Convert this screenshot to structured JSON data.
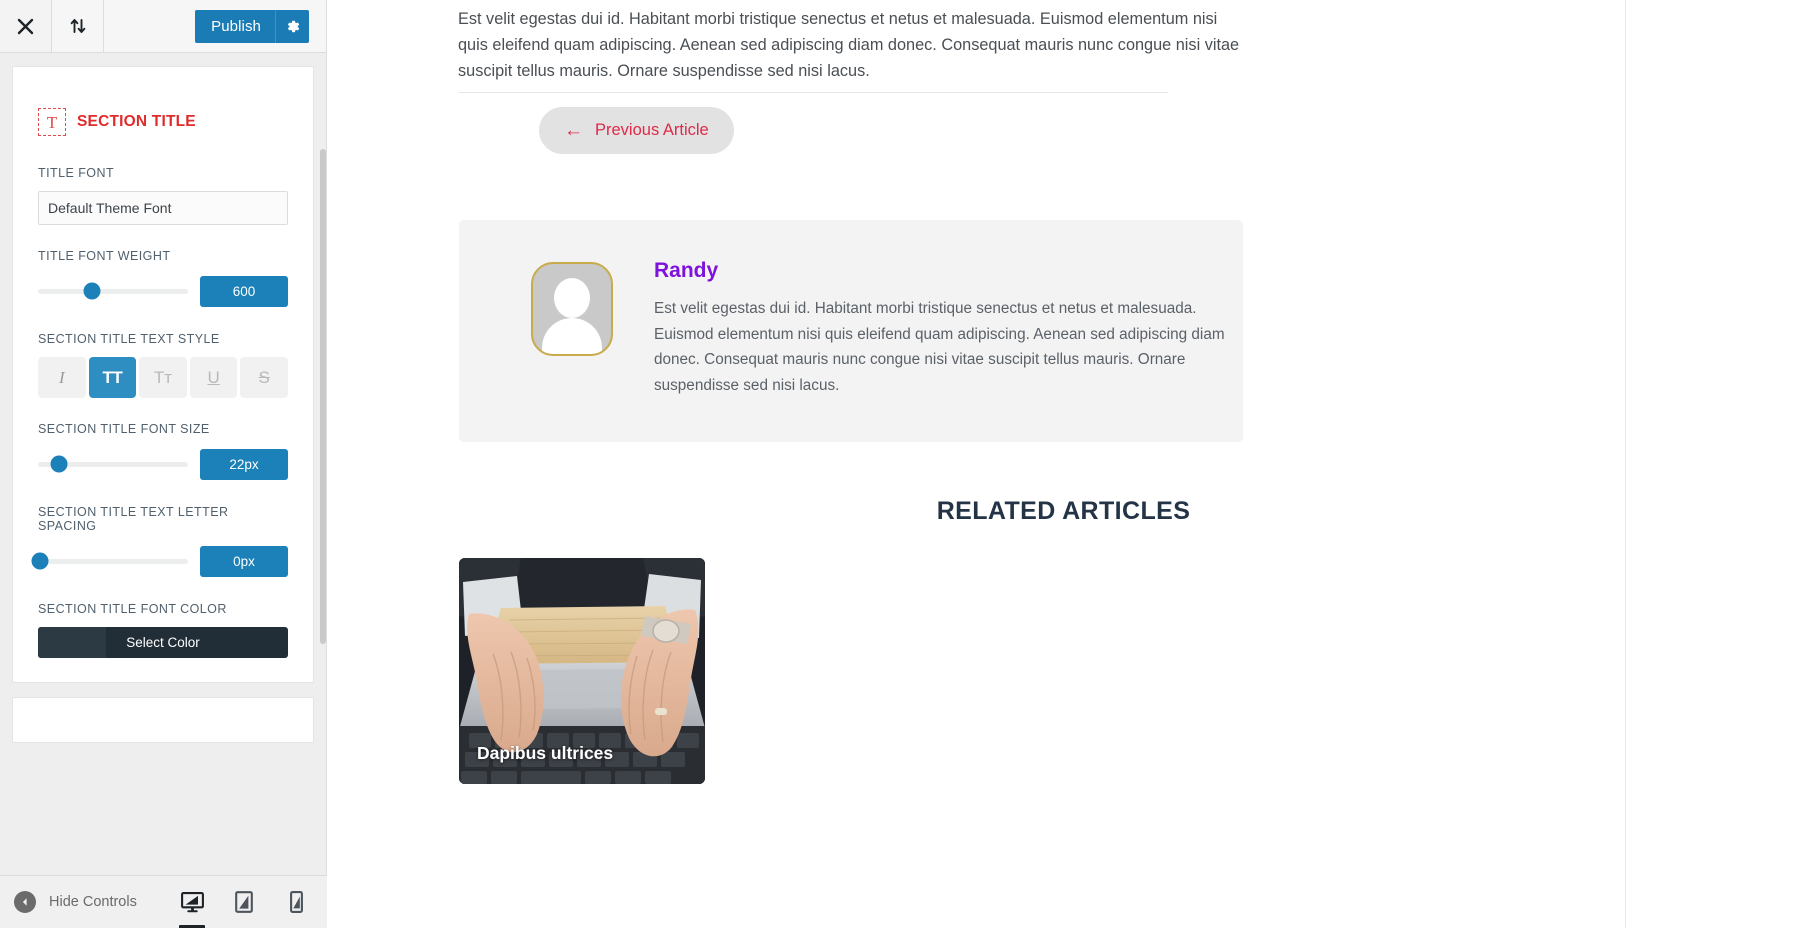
{
  "customizer": {
    "header": {
      "close_icon": "close-icon",
      "reorder_icon": "sort-updown-icon",
      "publish_label": "Publish",
      "gear_icon": "gear-icon"
    },
    "section": {
      "icon": "text-tool-icon",
      "title": "SECTION TITLE"
    },
    "controls": [
      {
        "label": "TITLE FONT",
        "type": "select",
        "value": "Default Theme Font"
      },
      {
        "label": "TITLE FONT WEIGHT",
        "type": "slider",
        "value": "600",
        "knob_percent": 36
      },
      {
        "label": "SECTION TITLE TEXT STYLE",
        "type": "style-group",
        "options": [
          {
            "name": "italic-button",
            "glyph": "I",
            "active": false
          },
          {
            "name": "uppercase-button",
            "glyph": "TT",
            "active": true
          },
          {
            "name": "capitalize-button",
            "glyph": "Tт",
            "active": false
          },
          {
            "name": "underline-button",
            "glyph": "U",
            "active": false
          },
          {
            "name": "strikethrough-button",
            "glyph": "S",
            "active": false
          }
        ]
      },
      {
        "label": "SECTION TITLE FONT SIZE",
        "type": "slider",
        "value": "22px",
        "knob_percent": 14
      },
      {
        "label": "SECTION TITLE TEXT LETTER SPACING",
        "type": "slider",
        "value": "0px",
        "knob_percent": 1
      },
      {
        "label": "SECTION TITLE FONT COLOR",
        "type": "color",
        "value": "Select Color",
        "swatch_hex": "#2c3a44"
      }
    ],
    "footer": {
      "hide_controls_label": "Hide Controls",
      "collapse_icon": "chevron-left-circle-icon",
      "devices": [
        {
          "name": "desktop",
          "icon": "desktop-icon",
          "active": true
        },
        {
          "name": "tablet",
          "icon": "tablet-icon",
          "active": false
        },
        {
          "name": "mobile",
          "icon": "mobile-icon",
          "active": false
        }
      ]
    }
  },
  "preview": {
    "intro_paragraph": "Est velit egestas dui id. Habitant morbi tristique senectus et netus et malesuada. Euismod elementum nisi quis eleifend quam adipiscing. Aenean sed adipiscing diam donec. Consequat mauris nunc congue nisi vitae suscipit tellus mauris. Ornare suspendisse sed nisi lacus.",
    "previous_article": {
      "arrow": "←",
      "label": "Previous Article"
    },
    "author": {
      "name": "Randy",
      "avatar_icon": "user-placeholder-icon",
      "bio": "Est velit egestas dui id. Habitant morbi tristique senectus et netus et malesuada. Euismod elementum nisi quis eleifend quam adipiscing. Aenean sed adipiscing diam donec. Consequat mauris nunc congue nisi vitae suscipit tellus mauris. Ornare suspendisse sed nisi lacus."
    },
    "related": {
      "heading": "RELATED ARTICLES",
      "cards": [
        {
          "title": "Dapibus ultrices",
          "image_alt": "hands-typing-on-laptop"
        }
      ]
    }
  },
  "colors": {
    "accent_blue": "#1b81b8",
    "section_red": "#e02b2b",
    "author_purple": "#7d12dd",
    "link_red": "#e0294a",
    "heading_navy": "#243447"
  }
}
